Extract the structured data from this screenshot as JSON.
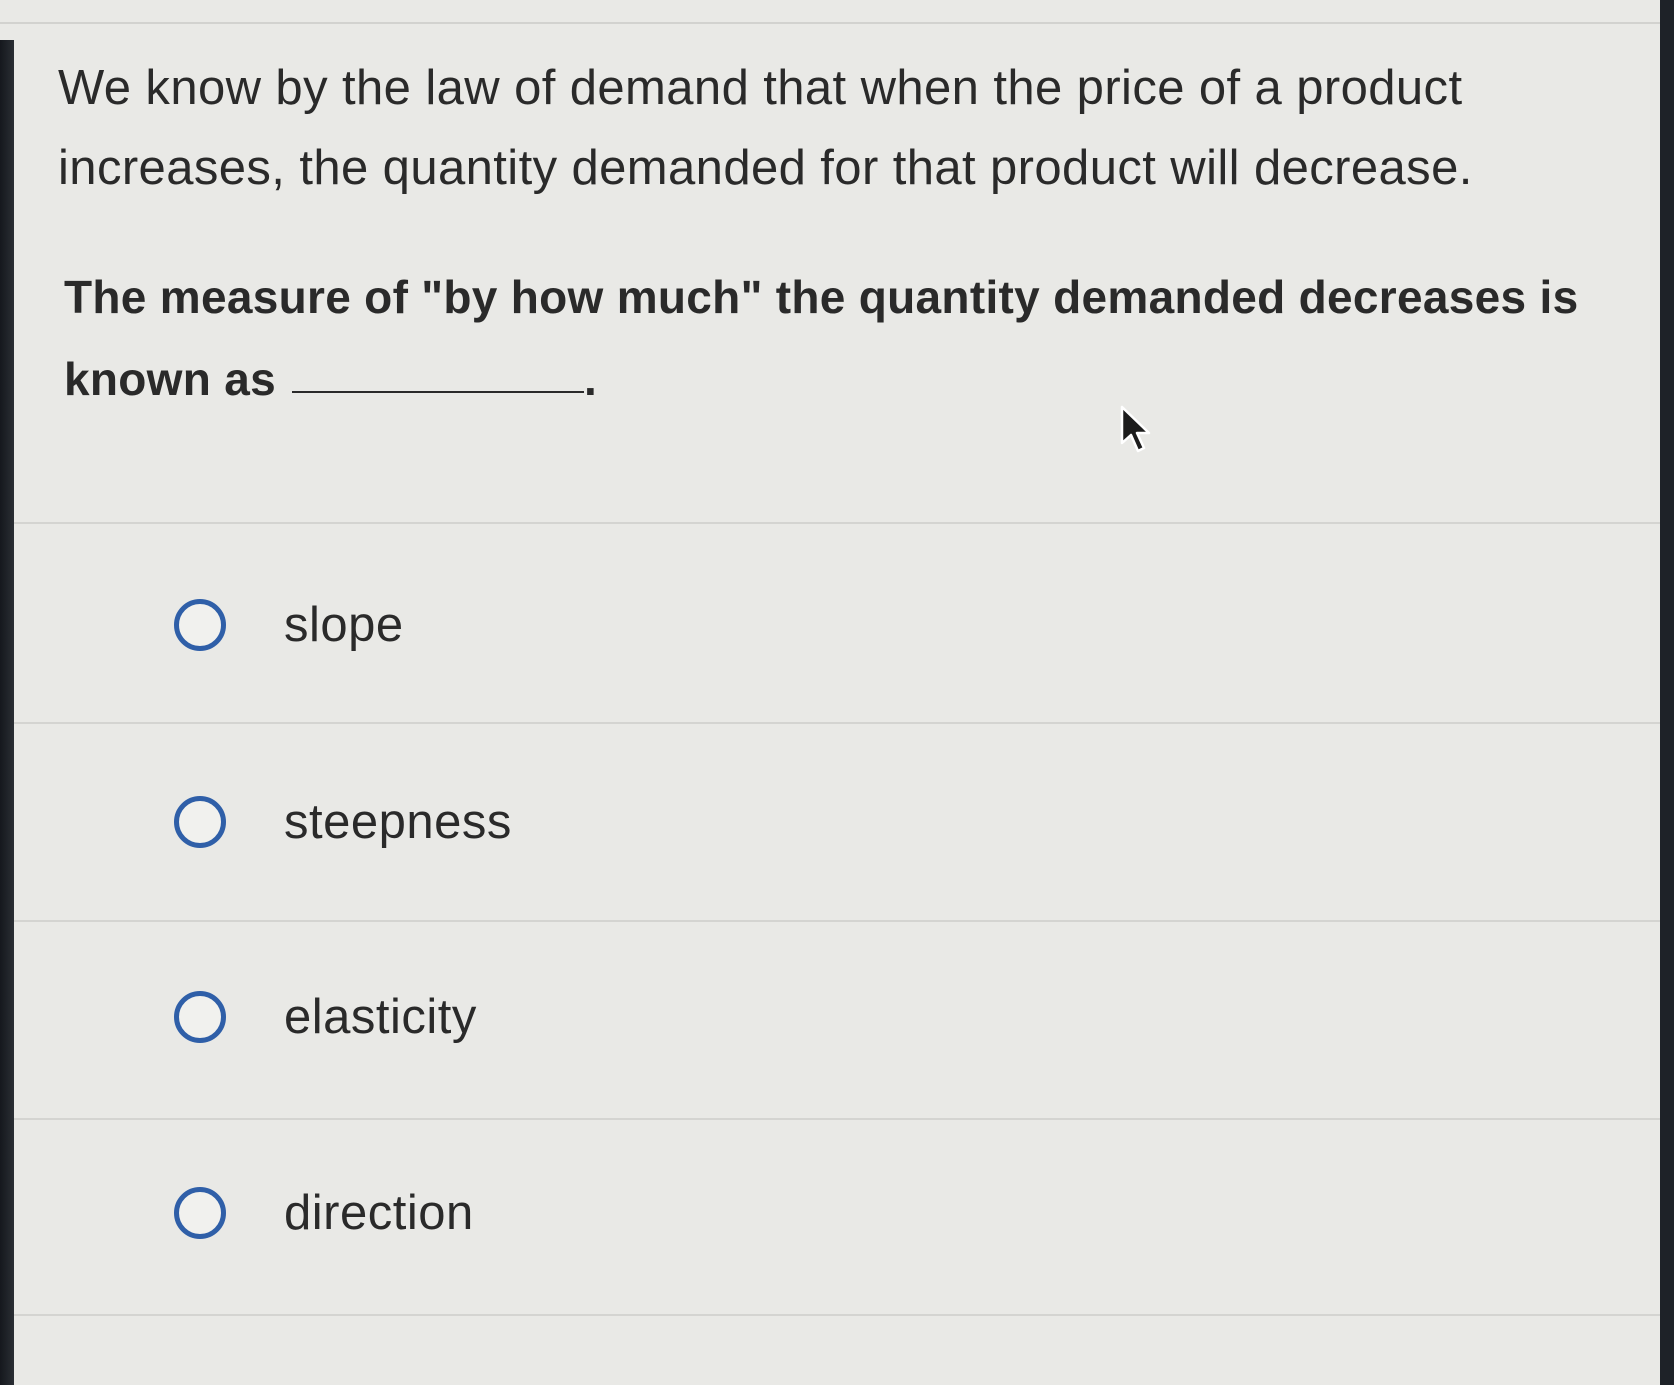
{
  "question": {
    "intro": "We know by the law of demand that when the price of a product increases, the quantity demanded for that product will decrease.",
    "prompt": "The measure of \"by how much\" the quantity demanded decreases is known as",
    "prompt_end": "."
  },
  "options": [
    {
      "label": "slope",
      "selected": false
    },
    {
      "label": "steepness",
      "selected": false
    },
    {
      "label": "elasticity",
      "selected": false
    },
    {
      "label": "direction",
      "selected": false
    }
  ],
  "colors": {
    "radio_border": "#2f5fa8",
    "background": "#e9e9e6",
    "text": "#2a2a2a"
  },
  "icons": {
    "cursor": "mouse-pointer-icon",
    "radio": "radio-unchecked-icon"
  }
}
